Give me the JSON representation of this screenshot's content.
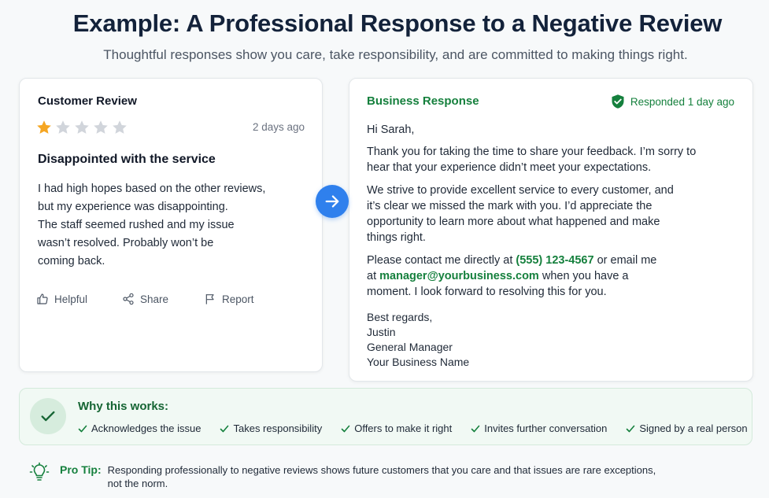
{
  "header": {
    "title": "Example: A Professional Response to a Negative Review",
    "subtitle": "Thoughtful responses show you care, take responsibility, and are committed to making things right."
  },
  "review": {
    "label": "Customer Review",
    "rating": 1,
    "max_rating": 5,
    "time": "2 days ago",
    "title": "Disappointed with the service",
    "body": "I had high hopes based on the other reviews,\nbut my experience was disappointing.\nThe staff seemed rushed and my issue\nwasn’t resolved. Probably won’t be\ncoming back.",
    "actions": {
      "helpful": "Helpful",
      "share": "Share",
      "report": "Report"
    }
  },
  "response": {
    "label": "Business Response",
    "status": "Responded 1 day ago",
    "greeting": "Hi Sarah,",
    "paragraph1": "Thank you for taking the time to share your feedback. I’m sorry to hear that your experience didn’t meet your expectations.",
    "paragraph2": "We strive to provide excellent service to every customer, and it’s clear we missed the mark with you. I’d appreciate the opportunity to learn more about what happened and make things right.",
    "contact_pre": "Please contact me directly at ",
    "phone": "(555) 123-4567",
    "contact_mid": " or email me at ",
    "email": "manager@yourbusiness.com",
    "contact_post": " when you have a moment. I look forward to resolving this for you.",
    "signoff": "Best regards,",
    "name": "Justin",
    "role": "General Manager",
    "business": "Your Business Name"
  },
  "why": {
    "title": "Why this works:",
    "items": [
      "Acknowledges the issue",
      "Takes responsibility",
      "Offers to make it right",
      "Invites further conversation",
      "Signed by a real person"
    ]
  },
  "protip": {
    "label": "Pro Tip:",
    "text": "Responding professionally to negative reviews shows future customers that you care and that issues are rare exceptions, not the norm."
  },
  "colors": {
    "accent_green": "#15803d",
    "star_filled": "#f5a623",
    "star_empty": "#d1d5db",
    "arrow_blue": "#2f80ed",
    "title_navy": "#13223a"
  },
  "icons": {
    "rating": "star-icon",
    "helpful": "thumbs-up-icon",
    "share": "share-icon",
    "report": "flag-icon",
    "arrow": "arrow-right-icon",
    "responded": "shield-check-icon",
    "why": "check-circle-icon",
    "protip": "lightbulb-icon"
  }
}
